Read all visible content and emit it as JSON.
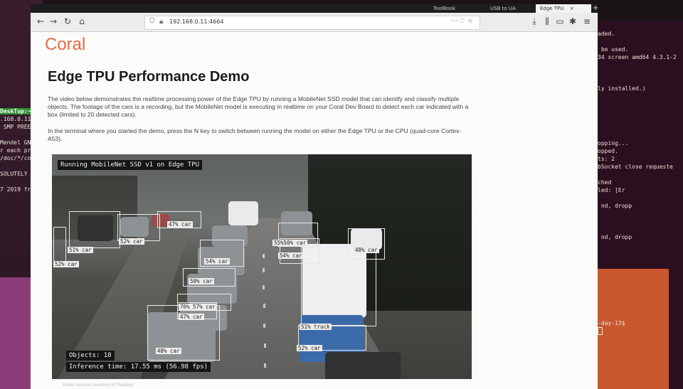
{
  "browser": {
    "tabs": [
      {
        "label": "ToolBook"
      },
      {
        "label": "USB to UA"
      },
      {
        "label": "Edge TPU"
      }
    ],
    "close_glyph": "×",
    "new_tab_glyph": "+",
    "url": "192.168.0.11:4664",
    "icons": [
      "back-icon",
      "forward-icon",
      "reload-icon",
      "home-icon",
      "shield-icon",
      "lock-icon",
      "more-icon",
      "pocket-icon",
      "star-icon",
      "download-icon",
      "library-icon",
      "sidebar-icon",
      "extension-icon",
      "menu-icon"
    ]
  },
  "page": {
    "logo": "Coral",
    "title": "Edge TPU Performance Demo",
    "paragraph1": "The video below demonstrates the realtime processing power of the Edge TPU by running a MobileNet SSD model that can identify and classify multiple objects. The footage of the cars is a recording, but the MobileNet model is executing in realtime on your Coral Dev Board to detect each car indicated with a box (limited to 20 detected cars).",
    "paragraph2": "In the terminal where you started the demo, press the N key to switch between running the model on either the Edge TPU or the CPU (quad-core Cortex-A53).",
    "caption": "Video source courtesy of Pixabay"
  },
  "video": {
    "header": "Running MobileNet SSD v1 on Edge TPU",
    "objects": "Objects: 18",
    "inference": "Inference time: 17.55 ms (56.98 fps)",
    "detections": [
      {
        "label": "47% car"
      },
      {
        "label": "52% car"
      },
      {
        "label": "51% car"
      },
      {
        "label": "52% car"
      },
      {
        "label": "54% car"
      },
      {
        "label": "50% car"
      },
      {
        "label": "76% 57% car"
      },
      {
        "label": "47% car"
      },
      {
        "label": "48% car"
      },
      {
        "label": "55%50% car"
      },
      {
        "label": "54% car"
      },
      {
        "label": "48% car"
      },
      {
        "label": "51% truck"
      },
      {
        "label": "52% car"
      }
    ]
  },
  "terminal_left": [
    "DeskTop:~",
    ".168.0.11",
    " SMP PREE",
    "",
    "Mendel GN",
    "r each pr",
    "/doc/*/cop",
    "",
    "SOLUTELY N",
    "",
    "7 2019 fro"
  ],
  "terminal_right": [
    "aded.",
    "",
    " be used.",
    "34 screen amd64 4.3.1-2",
    "",
    "",
    "",
    "ly installed.)",
    "",
    "",
    "",
    "",
    "",
    "",
    "opping...",
    "opped.",
    "ts: 2",
    "bSocket close requeste",
    "",
    "ched",
    "led: [Er",
    "",
    " nd, dropp",
    "",
    "",
    "",
    " nd, dropp",
    "",
    "",
    "",
    "",
    "",
    "",
    "",
    "",
    "",
    "",
    "-day-13$"
  ],
  "colors": {
    "coral": "#e56a45"
  }
}
